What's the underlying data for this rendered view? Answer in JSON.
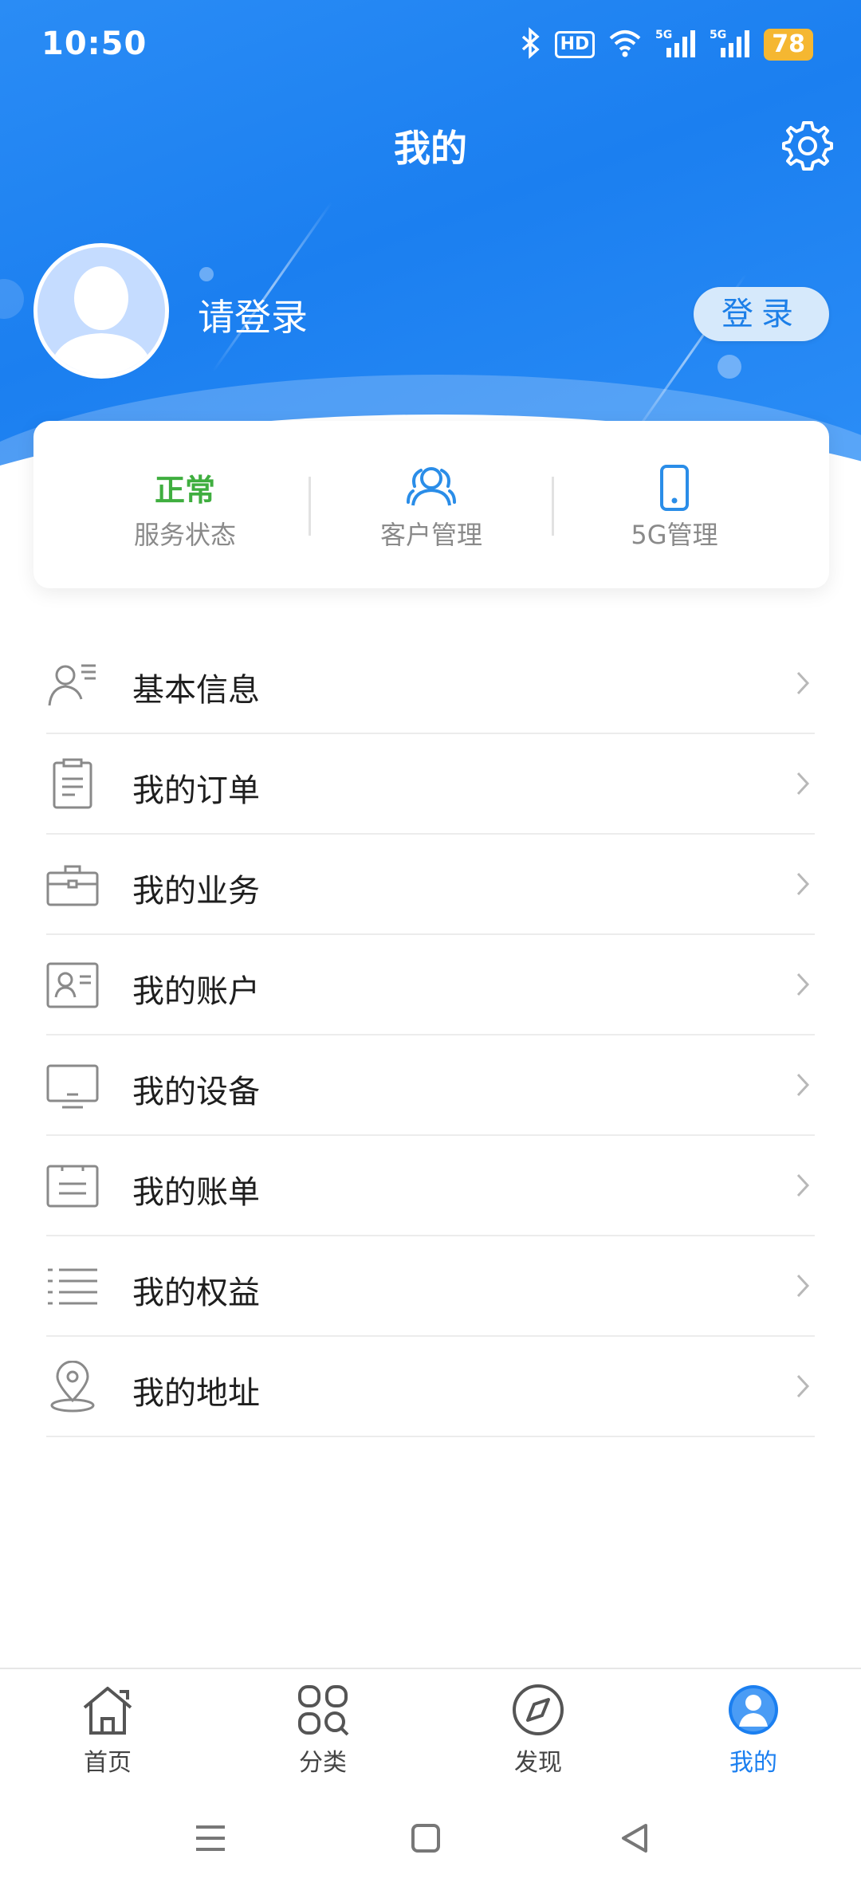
{
  "status_bar": {
    "time": "10:50",
    "hd_label": "HD",
    "battery": "78",
    "icons": [
      "bluetooth-icon",
      "hd-icon",
      "wifi-icon",
      "signal-5g-icon",
      "signal-5g-icon",
      "battery-icon"
    ]
  },
  "header": {
    "title": "我的",
    "settings_icon": "gear-icon"
  },
  "profile": {
    "login_prompt": "请登录",
    "login_button": "登录"
  },
  "status_card": {
    "service_status_value": "正常",
    "service_status_label": "服务状态",
    "customer_mgmt_label": "客户管理",
    "g5_mgmt_label": "5G管理",
    "status_color": "#3fae3f",
    "icon_color": "#2a8de8"
  },
  "menu": {
    "items": [
      {
        "label": "基本信息",
        "icon": "user-info-icon"
      },
      {
        "label": "我的订单",
        "icon": "clipboard-icon"
      },
      {
        "label": "我的业务",
        "icon": "briefcase-icon"
      },
      {
        "label": "我的账户",
        "icon": "id-card-icon"
      },
      {
        "label": "我的设备",
        "icon": "monitor-icon"
      },
      {
        "label": "我的账单",
        "icon": "bill-icon"
      },
      {
        "label": "我的权益",
        "icon": "list-icon"
      },
      {
        "label": "我的地址",
        "icon": "location-pin-icon"
      }
    ]
  },
  "bottom_nav": {
    "items": [
      {
        "label": "首页",
        "icon": "home-icon"
      },
      {
        "label": "分类",
        "icon": "category-icon"
      },
      {
        "label": "发现",
        "icon": "compass-icon"
      },
      {
        "label": "我的",
        "icon": "profile-icon",
        "active": true
      }
    ],
    "active_color": "#1b7ff0"
  },
  "theme": {
    "header_blue": "#1b7ff0"
  }
}
